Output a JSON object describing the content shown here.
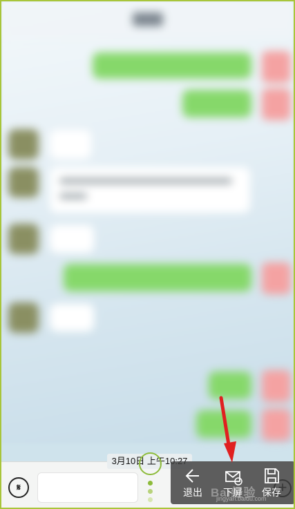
{
  "timestamp": "3月10日 上午10:27",
  "actions": [
    {
      "label": "退出",
      "icon": "arrow-left-icon"
    },
    {
      "label": "下屏",
      "icon": "mail-down-icon"
    },
    {
      "label": "保存",
      "icon": "save-icon"
    }
  ],
  "watermark": {
    "text": "Bai经验",
    "sub": "jingyan.baidu.com"
  },
  "colors": {
    "accent_green": "#86d86a",
    "annotation_red": "#e02020",
    "panel_bg": "#3c3c3c"
  }
}
